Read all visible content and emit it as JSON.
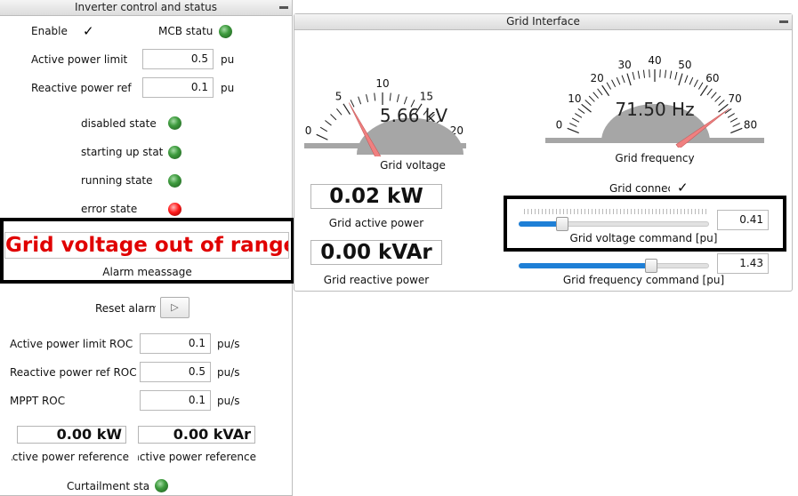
{
  "left_panel": {
    "title": "Inverter control and status",
    "enable_label": "Enable",
    "enable_checked": true,
    "mcb_label": "MCB status",
    "active_power_limit_label": "Active power limit",
    "active_power_limit_value": "0.5",
    "active_power_limit_unit": "pu",
    "reactive_power_ref_label": "Reactive power ref",
    "reactive_power_ref_value": "0.1",
    "reactive_power_ref_unit": "pu",
    "states": [
      {
        "label": "disabled state",
        "color": "#3f9c3f"
      },
      {
        "label": "starting up state",
        "color": "#3f9c3f"
      },
      {
        "label": "running state",
        "color": "#3f9c3f"
      },
      {
        "label": "error state",
        "color": "#ff1a1a"
      }
    ],
    "alarm_message": "Grid voltage out of range",
    "alarm_color": "#e00000",
    "alarm_caption": "Alarm meassage",
    "reset_alarm_label": "Reset alarm",
    "reset_icon": "play-icon",
    "active_power_limit_roc_label": "Active power limit ROC",
    "active_power_limit_roc_value": "0.1",
    "reactive_power_ref_roc_label": "Reactive power ref ROC",
    "reactive_power_ref_roc_value": "0.5",
    "mppt_roc_label": "MPPT ROC",
    "mppt_roc_value": "0.1",
    "roc_unit": "pu/s",
    "active_power_reference_value": "0.00 kW",
    "active_power_reference_label": "Active power reference",
    "reactive_power_reference_value": "0.00 kVAr",
    "reactive_power_reference_label": "Reactive power reference",
    "curtailment_label": "Curtailment state"
  },
  "grid_panel": {
    "title": "Grid Interface",
    "voltage_gauge": {
      "ticks": [
        "0",
        "5",
        "10",
        "15",
        "20"
      ],
      "min": 0,
      "max": 20,
      "value": 5.66,
      "readout": "5.66 kV",
      "caption": "Grid voltage"
    },
    "frequency_gauge": {
      "ticks": [
        "0",
        "10",
        "20",
        "30",
        "40",
        "50",
        "60",
        "70",
        "80"
      ],
      "min": 0,
      "max": 80,
      "value": 71.5,
      "readout": "71.50 Hz",
      "caption": "Grid frequency"
    },
    "needle_color": "#f08080",
    "grid_connect_label": "Grid connect",
    "grid_connect_checked": true,
    "active_power_value": "0.02 kW",
    "active_power_caption": "Grid active power",
    "reactive_power_value": "0.00 kVAr",
    "reactive_power_caption": "Grid reactive power",
    "voltage_command": {
      "value": "0.41",
      "fraction": 0.21,
      "caption": "Grid voltage command [pu]"
    },
    "frequency_command": {
      "value": "1.43",
      "fraction": 0.71,
      "caption": "Grid frequency command [pu]"
    },
    "slider_color": "#1e7fd6"
  }
}
